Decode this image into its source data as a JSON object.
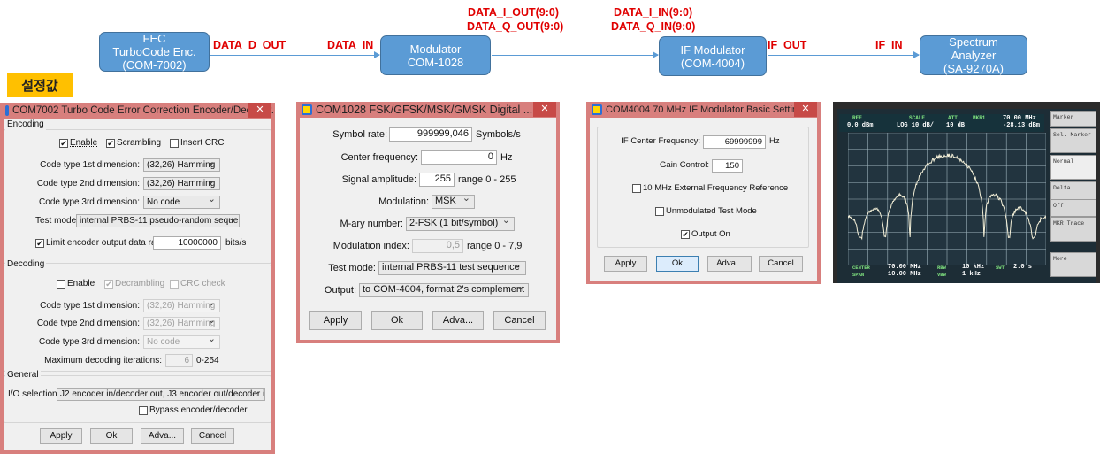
{
  "diagram": {
    "blocks": [
      {
        "line1": "FEC",
        "line2": "TurboCode Enc.",
        "line3": "(COM-7002)"
      },
      {
        "line1": "Modulator",
        "line2": "COM-1028"
      },
      {
        "line1": "IF Modulator",
        "line2": "(COM-4004)"
      },
      {
        "line1": "Spectrum",
        "line2": "Analyzer",
        "line3": "(SA-9270A)"
      }
    ],
    "signals": {
      "data_d_out": "DATA_D_OUT",
      "data_in": "DATA_IN",
      "data_i_out": "DATA_I_OUT(9:0)",
      "data_q_out": "DATA_Q_OUT(9:0)",
      "data_i_in": "DATA_I_IN(9:0)",
      "data_q_in": "DATA_Q_IN(9:0)",
      "if_out": "IF_OUT",
      "if_in": "IF_IN"
    },
    "colors": {
      "block": "#5b9bd5",
      "signal": "#e00000"
    }
  },
  "badge": "설정값",
  "com7002": {
    "title": "COM7002 Turbo Code Error Correction Encoder/Decoder...",
    "encoding": {
      "legend": "Encoding",
      "enable": "Enable",
      "scrambling": "Scrambling",
      "insert_crc": "Insert CRC",
      "enable_checked": true,
      "scrambling_checked": true,
      "insert_crc_checked": false,
      "code1_label": "Code type 1st dimension:",
      "code1": "(32,26) Hamming",
      "code2_label": "Code type 2nd dimension:",
      "code2": "(32,26) Hamming",
      "code3_label": "Code type 3rd dimension:",
      "code3": "No code",
      "test_label": "Test mode:",
      "test": "internal PRBS-11 pseudo-random sequence",
      "limit_label": "Limit encoder output data rate",
      "limit_checked": true,
      "rate": "10000000",
      "rate_unit": "bits/s"
    },
    "decoding": {
      "legend": "Decoding",
      "enable": "Enable",
      "decrambling": "Decrambling",
      "crc": "CRC check",
      "enable_checked": false,
      "decrambling_checked": true,
      "crc_checked": false,
      "code1_label": "Code type 1st dimension:",
      "code1": "(32,26) Hamming",
      "code2_label": "Code type 2nd dimension:",
      "code2": "(32,26) Hamming",
      "code3_label": "Code type 3rd dimension:",
      "code3": "No code",
      "iter_label": "Maximum decoding iterations:",
      "iter": "6",
      "iter_range": "0-254"
    },
    "general": {
      "legend": "General",
      "io_label": "I/O selection:",
      "io": "J2 encoder in/decoder out, J3 encoder out/decoder in",
      "bypass": "Bypass encoder/decoder",
      "bypass_checked": false
    },
    "buttons": {
      "apply": "Apply",
      "ok": "Ok",
      "adva": "Adva...",
      "cancel": "Cancel"
    }
  },
  "com1028": {
    "title": "COM1028 FSK/GFSK/MSK/GMSK Digital ...",
    "symbol_label": "Symbol rate:",
    "symbol": "999999,046",
    "symbol_unit": "Symbols/s",
    "cf_label": "Center frequency:",
    "cf": "0",
    "cf_unit": "Hz",
    "amp_label": "Signal amplitude:",
    "amp": "255",
    "amp_range": "range 0 - 255",
    "mod_label": "Modulation:",
    "mod": "MSK",
    "mary_label": "M-ary number:",
    "mary": "2-FSK (1 bit/symbol)",
    "idx_label": "Modulation index:",
    "idx": "0,5",
    "idx_range": "range 0 - 7,9",
    "test_label": "Test mode:",
    "test": "internal PRBS-11 test sequence",
    "out_label": "Output:",
    "out": "to COM-4004, format 2's complement",
    "buttons": {
      "apply": "Apply",
      "ok": "Ok",
      "adva": "Adva...",
      "cancel": "Cancel"
    }
  },
  "com4004": {
    "title": "COM4004 70 MHz IF Modulator Basic Settin...",
    "if_label": "IF Center Frequency:",
    "if": "69999999",
    "if_unit": "Hz",
    "gain_label": "Gain Control:",
    "gain": "150",
    "ext_ref": "10 MHz External Frequency Reference",
    "ext_ref_checked": false,
    "unmod": "Unmodulated Test Mode",
    "unmod_checked": false,
    "output_on": "Output On",
    "output_on_checked": true,
    "buttons": {
      "apply": "Apply",
      "ok": "Ok",
      "adva": "Adva...",
      "cancel": "Cancel"
    }
  },
  "analyzer": {
    "ref_label": "REF",
    "ref": "0.0 dBm",
    "scale_label": "SCALE",
    "scale": "LOG 10 dB/",
    "att_label": "ATT",
    "att": "10 dB",
    "mkr_label": "MKR1",
    "mkr_freq": "70.00 MHz",
    "mkr_level": "-28.13 dBm",
    "center_label": "CENTER",
    "center": "70.00 MHz",
    "span_label": "SPAN",
    "span": "10.00 MHz",
    "rbw_label": "RBW",
    "rbw": "10 kHz",
    "vbw_label": "VBW",
    "vbw": "1 kHz",
    "swt_label": "SWT",
    "swt": "2.0 s",
    "softkeys": [
      "Marker",
      "Sel. Marker",
      "Normal",
      "Delta",
      "Off",
      "MKR Trace",
      "More"
    ]
  }
}
